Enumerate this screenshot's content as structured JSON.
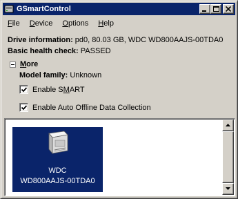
{
  "window": {
    "title": "GSmartControl",
    "titlebar_color": "#0a246a"
  },
  "menu": {
    "items": [
      {
        "underline": "F",
        "rest": "ile"
      },
      {
        "underline": "D",
        "rest": "evice"
      },
      {
        "underline": "O",
        "rest": "ptions"
      },
      {
        "underline": "H",
        "rest": "elp"
      }
    ]
  },
  "info": {
    "drive_label": "Drive information:",
    "drive_value": " pd0, 80.03 GB, WDC WD800AAJS-00TDA0",
    "health_label": "Basic health check:",
    "health_value": " PASSED"
  },
  "more": {
    "label_underline": "M",
    "label_rest": "ore",
    "model_family_label": "Model family:",
    "model_family_value": " Unknown",
    "enable_smart": {
      "pre": "Enable S",
      "underline": "M",
      "post": "ART",
      "checked": true
    },
    "auto_offline": {
      "label": "Enable Auto Offline Data Collection",
      "checked": true
    }
  },
  "drives": [
    {
      "line1": "WDC",
      "line2": "WD800AAJS-00TDA0",
      "icon": "hard-drive-icon",
      "selected": true
    }
  ],
  "colors": {
    "face": "#d4d0c8",
    "selection": "#0a246a"
  }
}
